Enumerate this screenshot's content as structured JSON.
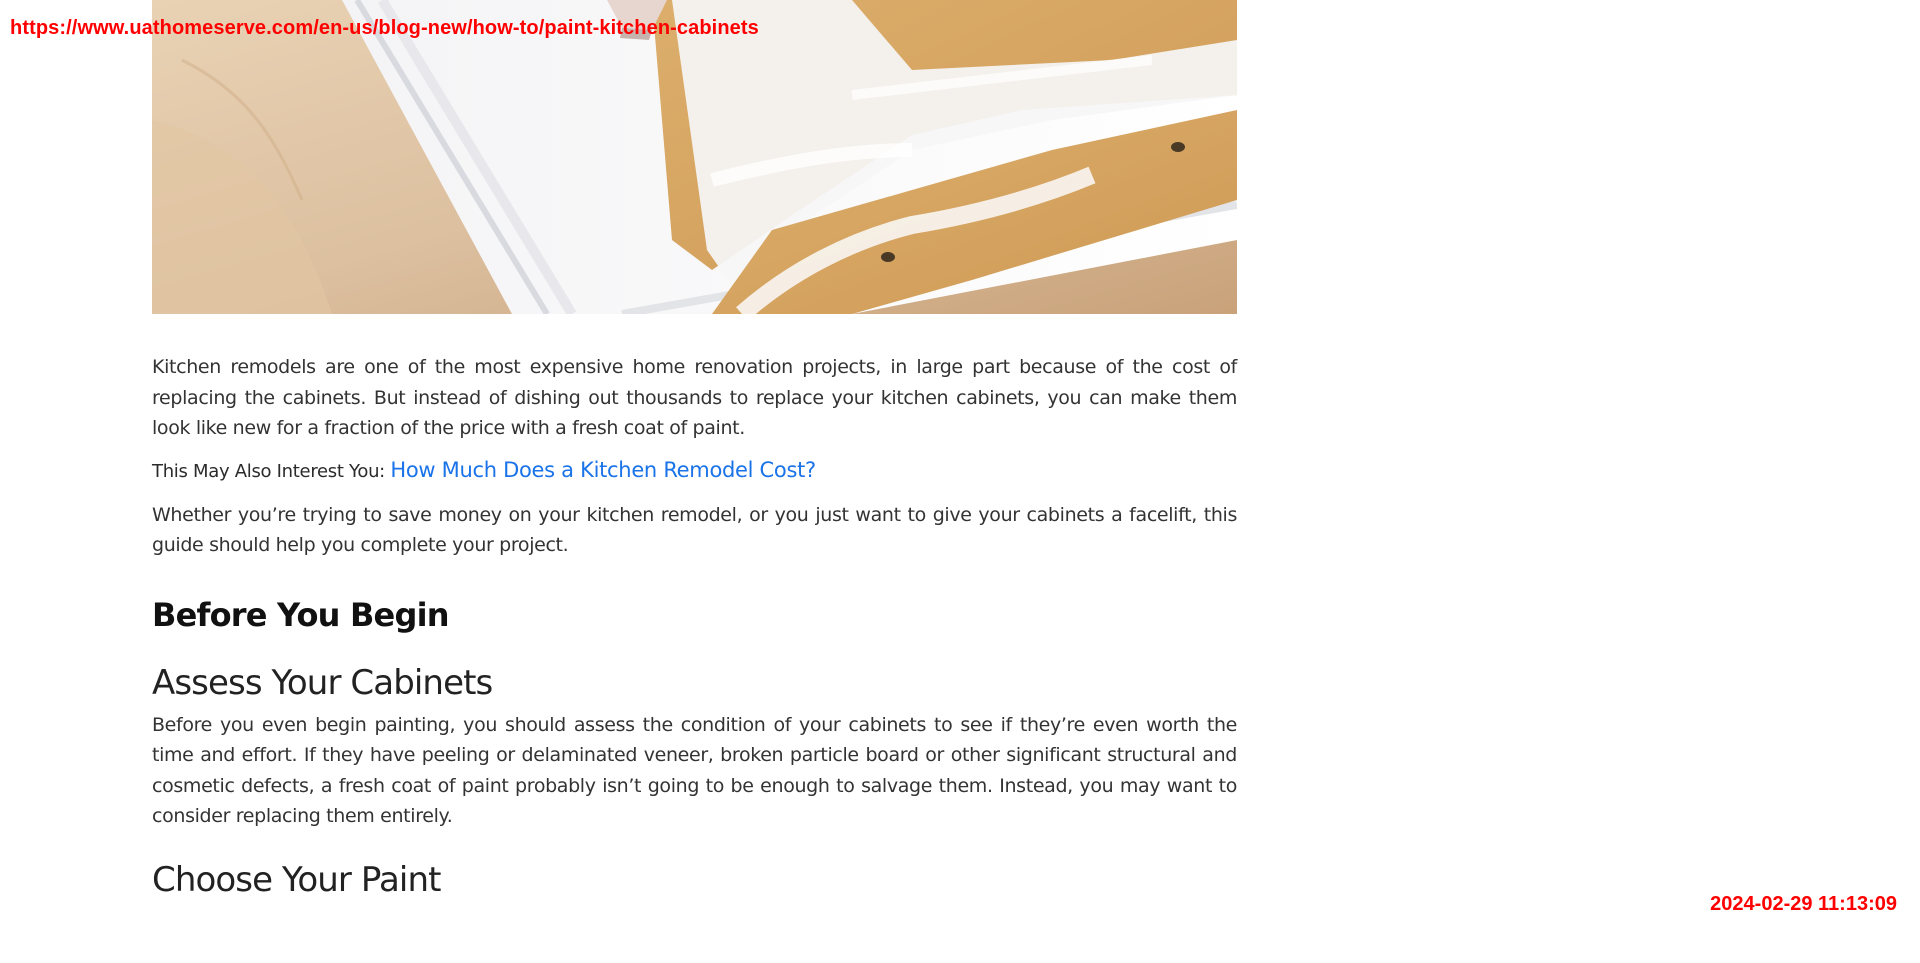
{
  "overlay": {
    "url": "https://www.uathomeserve.com/en-us/blog-new/how-to/paint-kitchen-cabinets",
    "timestamp": "2024-02-29 11:13:09"
  },
  "article": {
    "intro": "Kitchen remodels are one of the most expensive home renovation projects, in large part because of the cost of replacing the cabinets. But instead of dishing out thousands to replace your kitchen cabinets, you can make them look like new for a fraction of the price with a fresh coat of paint.",
    "related_prefix": "This May Also Interest You: ",
    "related_link": "How Much Does a Kitchen Remodel Cost?",
    "guide": "Whether you’re trying to save money on your kitchen remodel, or you just want to give your cabinets a facelift, this guide should help you complete your project.",
    "section_title": "Before You Begin",
    "assess_title": "Assess Your Cabinets",
    "assess_text": "Before you even begin painting, you should assess the condition of your cabinets to see if they’re even worth the time and effort. If they have peeling or delaminated veneer, broken particle board or other significant structural and cosmetic defects, a fresh coat of paint probably isn’t going to be enough to salvage them. Instead, you may want to consider replacing them entirely.",
    "paint_title": "Choose Your Paint"
  },
  "colors": {
    "overlay": "#ff0000",
    "link": "#1a73e8"
  }
}
